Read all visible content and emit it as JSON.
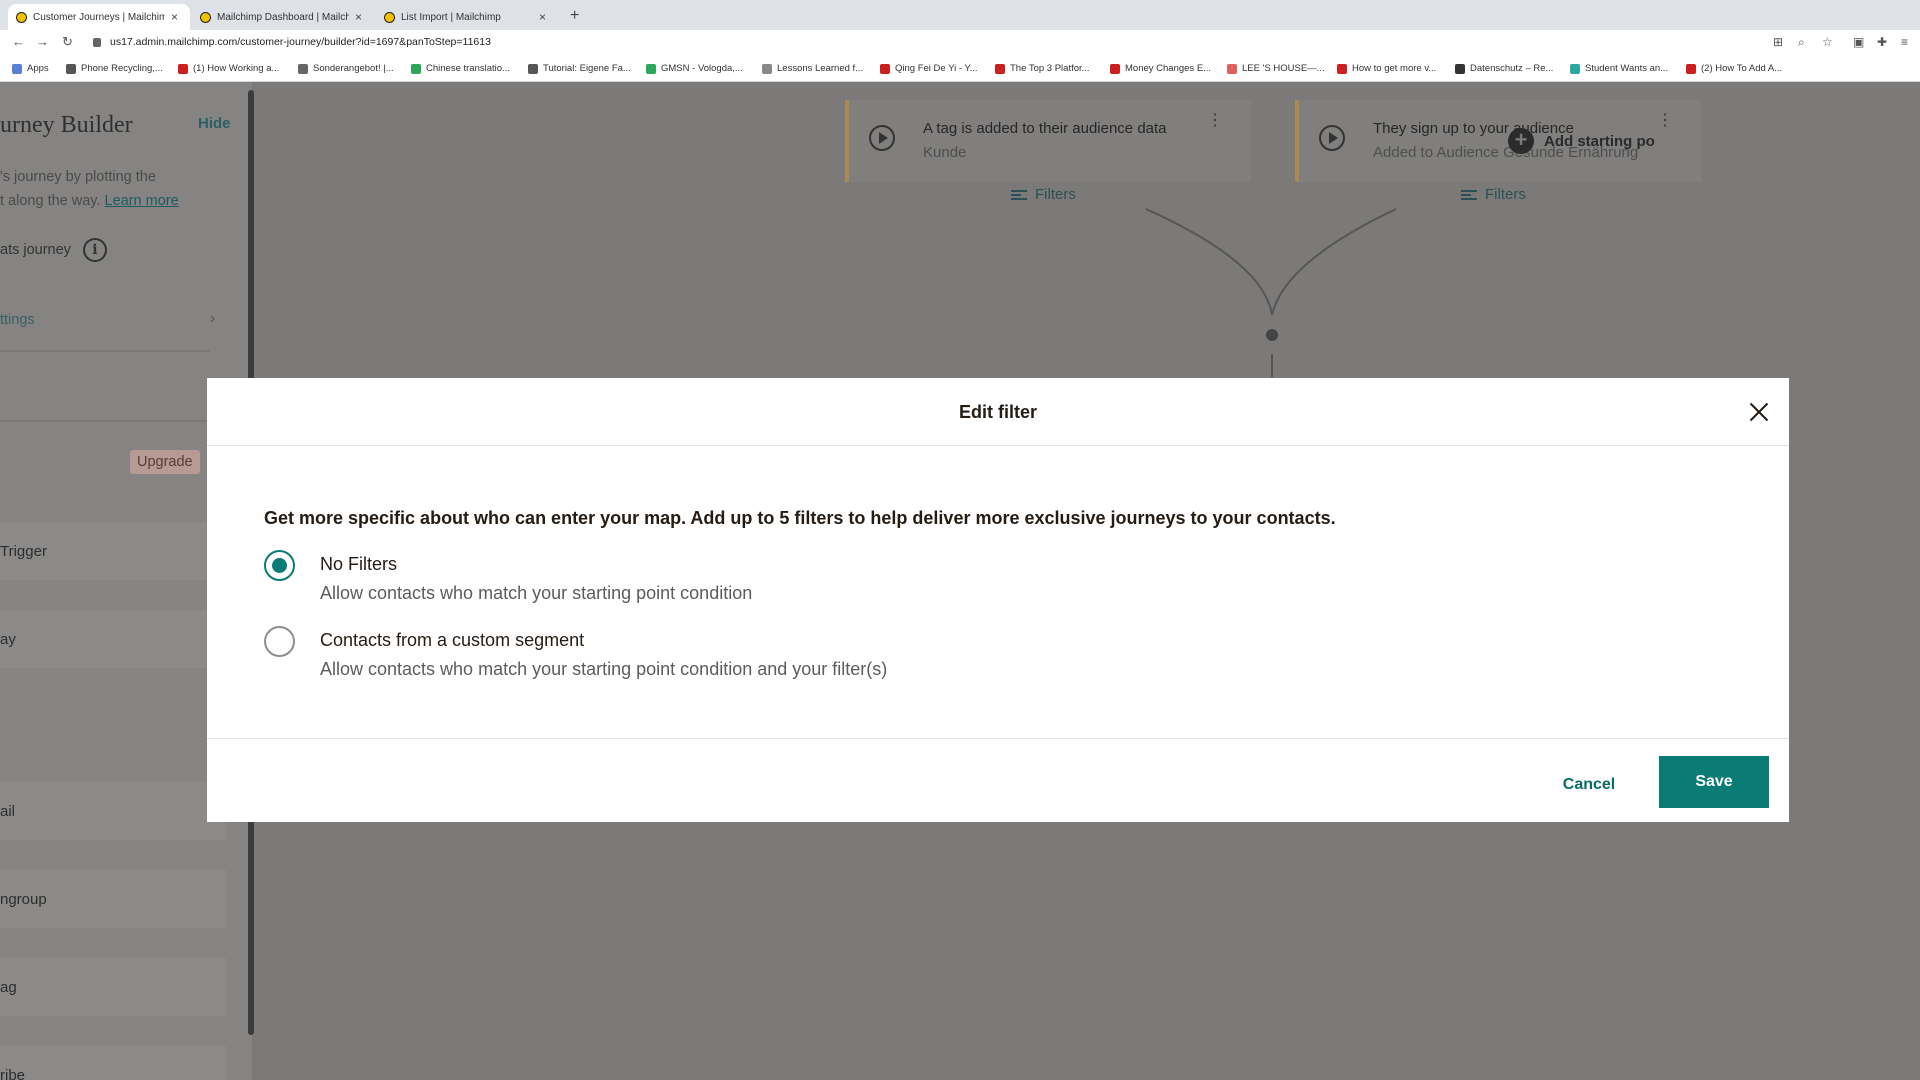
{
  "browser": {
    "tabs": [
      {
        "title": "Customer Journeys | Mailchim",
        "close": "×"
      },
      {
        "title": "Mailchimp Dashboard | Mailch",
        "close": "×"
      },
      {
        "title": "List Import | Mailchimp",
        "close": "×"
      }
    ],
    "new_tab": "+",
    "nav": {
      "back": "←",
      "forward": "→",
      "reload": "↻"
    },
    "url": "us17.admin.mailchimp.com/customer-journey/builder?id=1697&panToStep=11613",
    "bookmarks": [
      {
        "label": "Apps",
        "color": "#5b7ed8"
      },
      {
        "label": "Phone Recycling,...",
        "color": "#555555"
      },
      {
        "label": "(1) How Working a...",
        "color": "#cc1f1f"
      },
      {
        "label": "Sonderangebot! |...",
        "color": "#666666"
      },
      {
        "label": "Chinese translatio...",
        "color": "#2da85a"
      },
      {
        "label": "Tutorial: Eigene Fa...",
        "color": "#555555"
      },
      {
        "label": "GMSN - Vologda,...",
        "color": "#2da85a"
      },
      {
        "label": "Lessons Learned f...",
        "color": "#888888"
      },
      {
        "label": "Qing Fei De Yi - Y...",
        "color": "#cc1f1f"
      },
      {
        "label": "The Top 3 Platfor...",
        "color": "#cc1f1f"
      },
      {
        "label": "Money Changes E...",
        "color": "#cc1f1f"
      },
      {
        "label": "LEE 'S HOUSE—...",
        "color": "#e06060"
      },
      {
        "label": "How to get more v...",
        "color": "#cc1f1f"
      },
      {
        "label": "Datenschutz – Re...",
        "color": "#333333"
      },
      {
        "label": "Student Wants an...",
        "color": "#2da8a0"
      },
      {
        "label": "(2) How To Add A...",
        "color": "#cc1f1f"
      }
    ]
  },
  "sidebar": {
    "title": "urney Builder",
    "hide": "Hide",
    "desc": "'s journey by plotting the",
    "desc2": "t along the way.",
    "learn_more": "Learn more",
    "repeat": "ats journey",
    "info": "i",
    "settings": "ttings",
    "chevron": "›",
    "upgrade": "Upgrade",
    "items": [
      "Trigger",
      "ay",
      "ail",
      "ngroup",
      "ag",
      "ribe"
    ]
  },
  "canvas": {
    "starting_points": [
      {
        "title": "A tag is added to their audience data",
        "subtitle": "Kunde",
        "filters": "Filters"
      },
      {
        "title": "They sign up to your audience",
        "subtitle": "Added to Audience Gesunde Ernährung",
        "filters": "Filters"
      }
    ],
    "add_starting_point": "Add starting po",
    "more": "⋮"
  },
  "modal": {
    "title": "Edit filter",
    "intro": "Get more specific about who can enter your map. Add up to 5 filters to help deliver more exclusive journeys to your contacts.",
    "options": [
      {
        "label": "No Filters",
        "desc": "Allow contacts who match your starting point condition",
        "checked": true
      },
      {
        "label": "Contacts from a custom segment",
        "desc": "Allow contacts who match your starting point condition and your filter(s)",
        "checked": false
      }
    ],
    "cancel": "Cancel",
    "save": "Save"
  },
  "colors": {
    "accent": "#0b7b75",
    "overlay": "#7b7a78"
  }
}
